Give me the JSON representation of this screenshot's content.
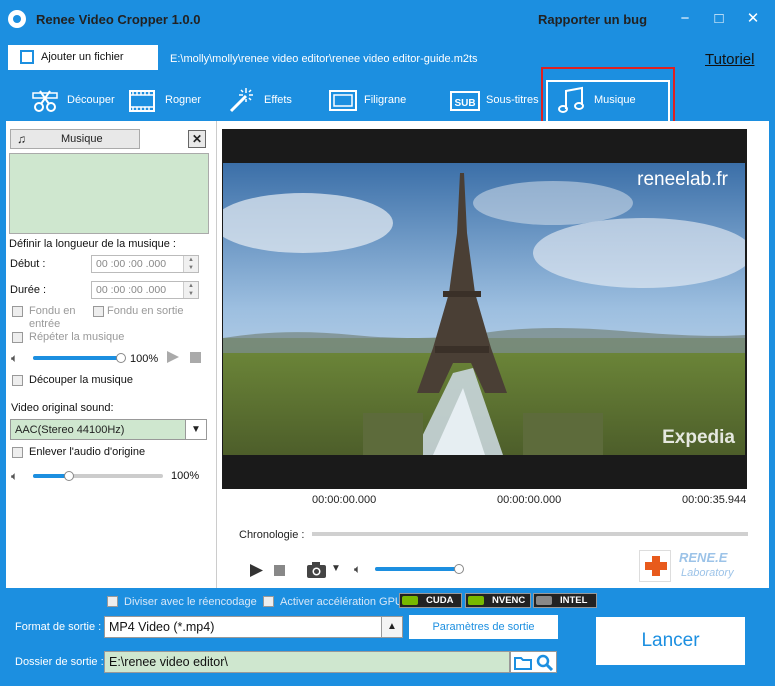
{
  "window": {
    "title": "Renee Video Cropper 1.0.0",
    "report_bug": "Rapporter un bug",
    "minimize_glyph": "−",
    "maximize_glyph": "□",
    "close_glyph": "✕"
  },
  "file": {
    "add_label": "Ajouter un fichier",
    "path": "E:\\molly\\molly\\renee video editor\\renee video editor-guide.m2ts",
    "tutorial": "Tutoriel"
  },
  "tabs": [
    {
      "label": "Découper",
      "icon": "scissors-film-icon"
    },
    {
      "label": "Rogner",
      "icon": "crop-icon"
    },
    {
      "label": "Effets",
      "icon": "magic-wand-icon"
    },
    {
      "label": "Filigrane",
      "icon": "watermark-icon"
    },
    {
      "label": "Sous-titres",
      "icon": "subtitle-icon"
    },
    {
      "label": "Musique",
      "icon": "music-note-icon",
      "active": true
    }
  ],
  "music_panel": {
    "button_label": "Musique",
    "close_glyph": "✕",
    "length_title": "Définir la longueur de la musique :",
    "start_label": "Début :",
    "start_value": "00 :00 :00 .000",
    "duration_label": "Durée :",
    "duration_value": "00 :00 :00 .000",
    "fade_in": "Fondu en entrée",
    "fade_out": "Fondu en sortie",
    "repeat": "Répéter la musique",
    "volume_value": 1.0,
    "volume_text": "100%",
    "cut_music": "Découper la musique",
    "orig_sound_label": "Video original sound:",
    "orig_sound_value": "AAC(Stereo 44100Hz)",
    "remove_audio": "Enlever l'audio d'origine",
    "orig_volume_value": 0.28,
    "orig_volume_text": "100%"
  },
  "preview": {
    "watermark": "reneelab.fr",
    "overlay_logo": "Expedia",
    "time_start": "00:00:00.000",
    "time_current": "00:00:00.000",
    "time_end": "00:00:35.944",
    "timeline_label": "Chronologie :",
    "player_volume_value": 0.95,
    "logo_line1": "RENE.E",
    "logo_line2": "Laboratory"
  },
  "bottom": {
    "split_encoding": "Diviser avec le réencodage",
    "gpu_accel": "Activer accélération GPU",
    "gpu_badges": [
      "CUDA",
      "NVENC",
      "INTEL"
    ],
    "format_label": "Format de sortie :",
    "format_value": "MP4 Video (*.mp4)",
    "params_button": "Paramètres de sortie",
    "dest_label": "Dossier de sortie :",
    "dest_value": "E:\\renee video editor\\",
    "launch_button": "Lancer"
  },
  "colors": {
    "accent": "#1c8fe0",
    "highlight": "#e02020",
    "field_green": "#cfe7cf"
  }
}
